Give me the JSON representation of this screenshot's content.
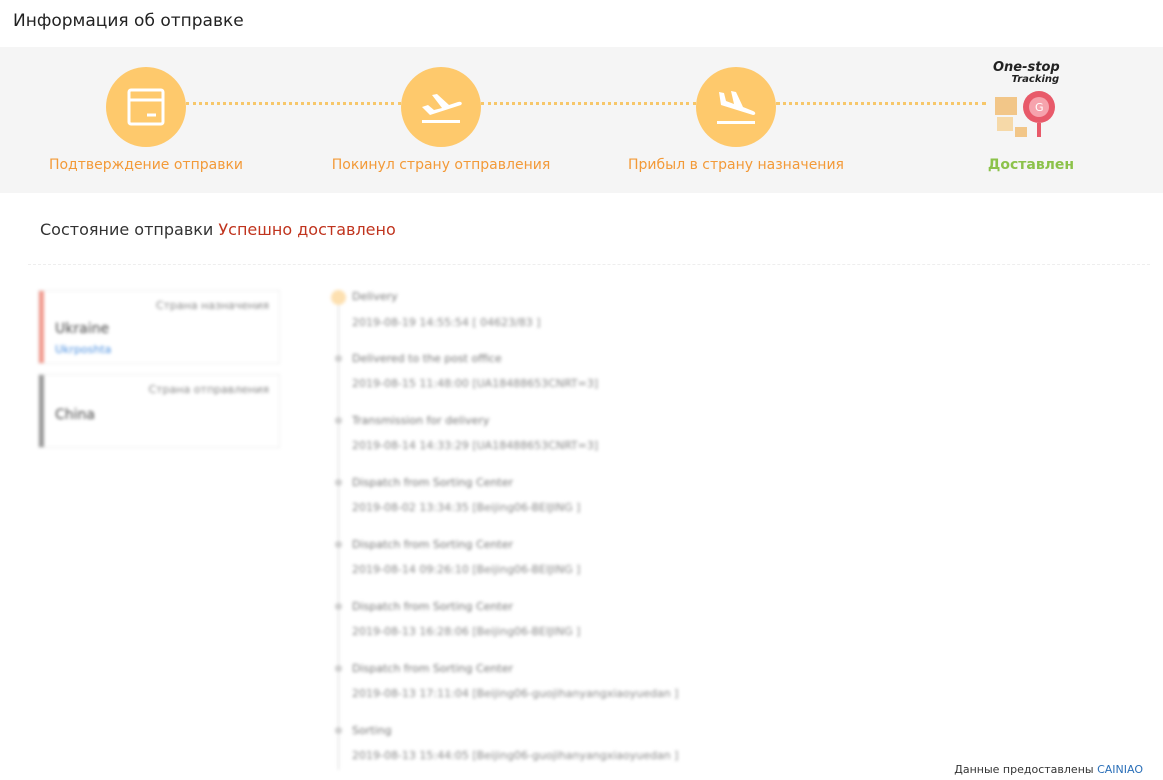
{
  "page": {
    "title": "Информация об отправке"
  },
  "progress": {
    "steps": [
      {
        "label": "Подтверждение отправки",
        "icon": "package-icon",
        "state": "done"
      },
      {
        "label": "Покинул страну отправления",
        "icon": "plane-departure-icon",
        "state": "done"
      },
      {
        "label": "Прибыл в страну назначения",
        "icon": "plane-arrival-icon",
        "state": "done"
      },
      {
        "label": "Доставлен",
        "icon": "one-stop-tracking-logo",
        "state": "current"
      }
    ],
    "logo": {
      "line1": "One-stop",
      "line2": "Tracking"
    },
    "colors": {
      "circle": "#fec96c",
      "label": "#f39a38",
      "delivered": "#8cc24a"
    }
  },
  "status": {
    "label": "Состояние отправки",
    "value": "Успешно доставлено",
    "value_color": "#c0341e"
  },
  "countries": {
    "destination": {
      "role": "Страна назначения",
      "name": "Ukraine",
      "link": "Ukrposhta",
      "bar_color": "#f29b8f"
    },
    "origin": {
      "role": "Страна отправления",
      "name": "China",
      "bar_color": "#999999"
    }
  },
  "events": [
    {
      "desc": "Delivery",
      "time": "2019-08-19 14:55:54 [ 04623/83 ]"
    },
    {
      "desc": "Delivered to the post office",
      "time": "2019-08-15 11:48:00 [UA18488653CNRT=3]"
    },
    {
      "desc": "Transmission for delivery",
      "time": "2019-08-14 14:33:29 [UA18488653CNRT=3]"
    },
    {
      "desc": "Dispatch from Sorting Center",
      "time": "2019-08-02 13:34:35 [Beijing06-BEIJING ]"
    },
    {
      "desc": "Dispatch from Sorting Center",
      "time": "2019-08-14 09:26:10 [Beijing06-BEIJING ]"
    },
    {
      "desc": "Dispatch from Sorting Center",
      "time": "2019-08-13 16:28:06 [Beijing06-BEIJING ]"
    },
    {
      "desc": "Dispatch from Sorting Center",
      "time": "2019-08-13 17:11:04 [Beijing06-guojihanyangxiaoyuedan ]"
    },
    {
      "desc": "Sorting",
      "time": "2019-08-13 15:44:05 [Beijing06-guojihanyangxiaoyuedan ]"
    }
  ],
  "credit": {
    "text": "Данные предоставлены",
    "source": "CAINIAO"
  }
}
